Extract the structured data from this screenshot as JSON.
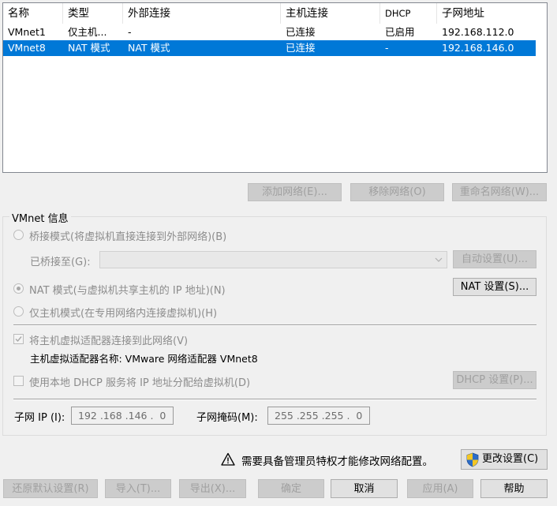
{
  "table": {
    "columns": [
      "名称",
      "类型",
      "外部连接",
      "主机连接",
      "DHCP",
      "子网地址"
    ],
    "rows": [
      [
        "VMnet1",
        "仅主机...",
        "-",
        "已连接",
        "已启用",
        "192.168.112.0"
      ],
      [
        "VMnet8",
        "NAT 模式",
        "NAT 模式",
        "已连接",
        "-",
        "192.168.146.0"
      ]
    ],
    "selected_index": 1
  },
  "list_buttons": {
    "add": "添加网络(E)...",
    "remove": "移除网络(O)",
    "rename": "重命名网络(W)..."
  },
  "vmnet_info": {
    "title": "VMnet 信息",
    "bridge_mode": "桥接模式(将虚拟机直接连接到外部网络)(B)",
    "bridged_to_label": "已桥接至(G):",
    "bridged_to_value": "",
    "auto_settings": "自动设置(U)...",
    "nat_mode": "NAT 模式(与虚拟机共享主机的 IP 地址)(N)",
    "nat_settings": "NAT 设置(S)...",
    "host_only_mode": "仅主机模式(在专用网络内连接虚拟机)(H)",
    "connect_host_adapter": "将主机虚拟适配器连接到此网络(V)",
    "host_adapter_name": "主机虚拟适配器名称: VMware 网络适配器 VMnet8",
    "use_dhcp": "使用本地 DHCP 服务将 IP 地址分配给虚拟机(D)",
    "dhcp_settings": "DHCP 设置(P)...",
    "subnet_ip_label": "子网 IP (I):",
    "subnet_ip_value": "192 .168 .146 .  0",
    "subnet_mask_label": "子网掩码(M):",
    "subnet_mask_value": "255 .255 .255 .  0",
    "selected_mode": "nat",
    "connect_host_adapter_checked": true,
    "use_dhcp_checked": false
  },
  "admin": {
    "warning": "需要具备管理员特权才能修改网络配置。",
    "change_settings": "更改设置(C)"
  },
  "footer": {
    "restore_defaults": "还原默认设置(R)",
    "import": "导入(T)...",
    "export": "导出(X)...",
    "ok": "确定",
    "cancel": "取消",
    "apply": "应用(A)",
    "help": "帮助"
  },
  "colors": {
    "selection": "#0078d7",
    "shield_blue": "#2b6cc8",
    "shield_yellow": "#f3c623"
  }
}
